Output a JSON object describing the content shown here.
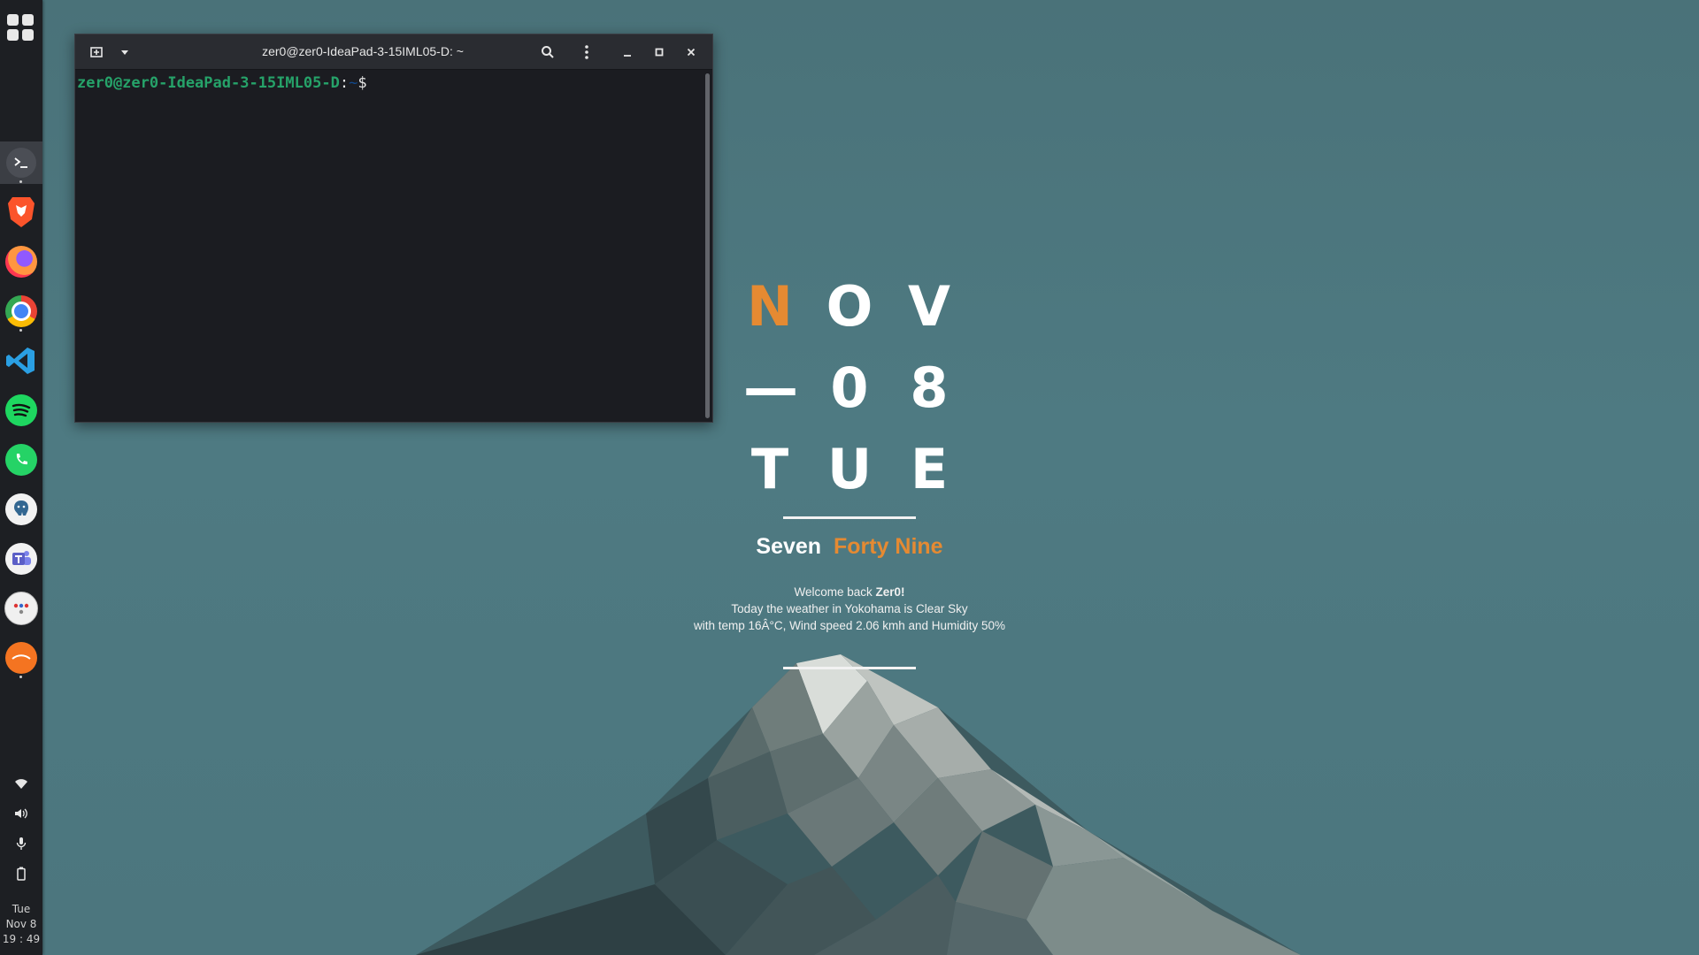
{
  "dock": {
    "apps": [
      {
        "name": "terminal",
        "color": "#3b3e44"
      },
      {
        "name": "brave",
        "color": "#fb542b"
      },
      {
        "name": "firefox",
        "color": "#ff7139"
      },
      {
        "name": "chrome",
        "color": "#4285f4"
      },
      {
        "name": "vscode",
        "color": "#2a9fe3"
      },
      {
        "name": "spotify",
        "color": "#1ed760"
      },
      {
        "name": "whatsapp",
        "color": "#25d366"
      },
      {
        "name": "pgadmin",
        "color": "#336791"
      },
      {
        "name": "teams",
        "color": "#5b5fc7"
      },
      {
        "name": "calendar",
        "color": "#f2f2f2"
      },
      {
        "name": "ubuntu-software",
        "color": "#f47421"
      }
    ],
    "tray_icons": [
      "wifi-icon",
      "volume-icon",
      "microphone-icon",
      "battery-icon"
    ],
    "clock": {
      "day": "Tue",
      "date": "Nov 8",
      "time": "19 : 49"
    }
  },
  "terminal": {
    "title": "zer0@zer0-IdeaPad-3-15IML05-D: ~",
    "prompt_user": "zer0@zer0-IdeaPad-3-15IML05-D",
    "prompt_colon": ":",
    "prompt_path": "~",
    "prompt_sign": "$"
  },
  "widget": {
    "month": [
      "N",
      "O",
      "V"
    ],
    "day": [
      "—",
      "0",
      "8"
    ],
    "weekday": [
      "T",
      "U",
      "E"
    ],
    "time_hours": "Seven",
    "time_minutes": "Forty Nine",
    "welcome_prefix": "Welcome back",
    "user": "Zer0!",
    "weather_line1": "Today the weather in Yokohama is Clear Sky",
    "weather_line2": "with temp 16Â°C, Wind speed 2.06 kmh and Humidity 50%"
  },
  "colors": {
    "accent": "#e58a32",
    "terminal_green": "#26a269",
    "desktop": "#4e7a82"
  }
}
